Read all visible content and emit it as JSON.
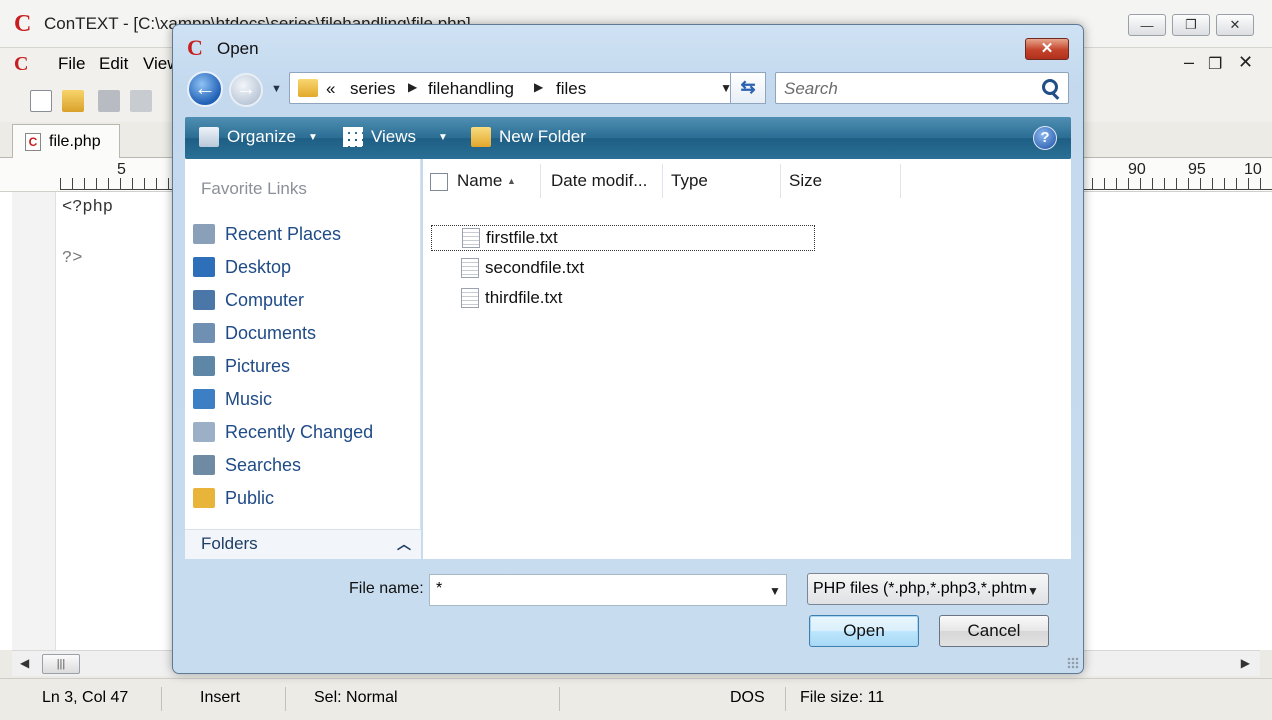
{
  "app": {
    "title": "ConTEXT - [C:\\xampp\\htdocs\\series\\filehandling\\file.php]",
    "logo_letter": "C",
    "window_buttons": [
      "—",
      "❐",
      "✕"
    ]
  },
  "menu": {
    "items": [
      "File",
      "Edit",
      "View"
    ],
    "mdi_min": "–",
    "mdi_restore": "❐",
    "mdi_close": "✕"
  },
  "tabs": [
    {
      "label": "file.php"
    }
  ],
  "ruler": {
    "left_labels": [
      "5"
    ],
    "right_labels": [
      "90",
      "95",
      "10"
    ]
  },
  "editor": {
    "lines": [
      "<?php",
      "",
      "?>"
    ]
  },
  "status": {
    "position": "Ln 3, Col 47",
    "mode": "Insert",
    "selection": "Sel: Normal",
    "encoding": "DOS",
    "file_size": "File size: 11"
  },
  "dialog": {
    "title": "Open",
    "close_label": "✕",
    "breadcrumb": [
      "«",
      "series",
      "filehandling",
      "files"
    ],
    "search_placeholder": "Search",
    "commands": {
      "organize": "Organize",
      "views": "Views",
      "new_folder": "New Folder",
      "help": "?"
    },
    "favorites_header": "Favorite Links",
    "favorites": [
      {
        "label": "Recent Places",
        "icon": "recent-places-icon",
        "color": "#8aa0b8"
      },
      {
        "label": "Desktop",
        "icon": "desktop-icon",
        "color": "#2d6fb8"
      },
      {
        "label": "Computer",
        "icon": "computer-icon",
        "color": "#4a77a8"
      },
      {
        "label": "Documents",
        "icon": "documents-icon",
        "color": "#6f8fb3"
      },
      {
        "label": "Pictures",
        "icon": "pictures-icon",
        "color": "#5e86a6"
      },
      {
        "label": "Music",
        "icon": "music-icon",
        "color": "#3d7fc4"
      },
      {
        "label": "Recently Changed",
        "icon": "recently-changed-icon",
        "color": "#9bb0c6"
      },
      {
        "label": "Searches",
        "icon": "searches-icon",
        "color": "#6f8aa3"
      },
      {
        "label": "Public",
        "icon": "public-folder-icon",
        "color": "#e8b43a"
      }
    ],
    "folders_label": "Folders",
    "columns": [
      "Name",
      "Date modif...",
      "Type",
      "Size"
    ],
    "files": [
      "firstfile.txt",
      "secondfile.txt",
      "thirdfile.txt"
    ],
    "filename_label": "File name:",
    "filename_value": "*",
    "filter_value": "PHP files (*.php,*.php3,*.phtm",
    "open_button": "Open",
    "cancel_button": "Cancel"
  },
  "colors": {
    "accent": "#1f5fb5",
    "command_bar": "#2b6d93",
    "link_text": "#1f4b86",
    "logo_red": "#c71f1f"
  }
}
